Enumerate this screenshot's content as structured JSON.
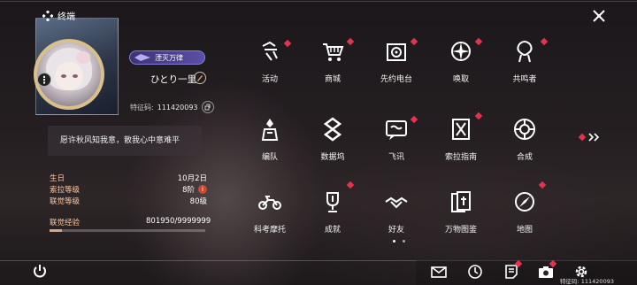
{
  "header": {
    "title": "终端"
  },
  "profile": {
    "title_badge": "湮灭万律",
    "player_name": "ひとり一里",
    "uid_label": "特征码:",
    "uid_value": "111420093",
    "signature": "愿许秋风知我意，散我心中意难平"
  },
  "stats": [
    {
      "label": "生日",
      "value": "10月2日"
    },
    {
      "label": "索拉等级",
      "value": "8阶"
    },
    {
      "label": "联觉等级",
      "value": "80级"
    }
  ],
  "xp": {
    "label": "联觉经验",
    "value": "801950/9999999",
    "current": 801950,
    "max": 9999999
  },
  "menu": [
    {
      "label": "活动",
      "icon": "event-icon",
      "dot": true
    },
    {
      "label": "商城",
      "icon": "shop-cart-icon",
      "dot": true
    },
    {
      "label": "先约电台",
      "icon": "radio-icon",
      "dot": true
    },
    {
      "label": "唤取",
      "icon": "summon-compass-icon",
      "dot": true
    },
    {
      "label": "共鸣者",
      "icon": "resonator-icon",
      "dot": true
    },
    {
      "label": "编队",
      "icon": "team-icon",
      "dot": false
    },
    {
      "label": "数据坞",
      "icon": "data-dock-icon",
      "dot": false
    },
    {
      "label": "飞讯",
      "icon": "message-icon",
      "dot": true
    },
    {
      "label": "索拉指南",
      "icon": "guidebook-icon",
      "dot": true
    },
    {
      "label": "合成",
      "icon": "synthesis-icon",
      "dot": false
    },
    {
      "label": "科考摩托",
      "icon": "motorcycle-icon",
      "dot": false
    },
    {
      "label": "成就",
      "icon": "trophy-icon",
      "dot": true
    },
    {
      "label": "好友",
      "icon": "friends-handshake-icon",
      "dot": false
    },
    {
      "label": "万物图鉴",
      "icon": "archive-cards-icon",
      "dot": true
    },
    {
      "label": "地图",
      "icon": "map-compass-icon",
      "dot": true
    }
  ],
  "footer": {
    "uid_text": "特征码: 111420093"
  },
  "colors": {
    "accent_red": "#e2344f",
    "label_peach": "#ffc9a6",
    "badge_purple": "#5a4ea8"
  }
}
